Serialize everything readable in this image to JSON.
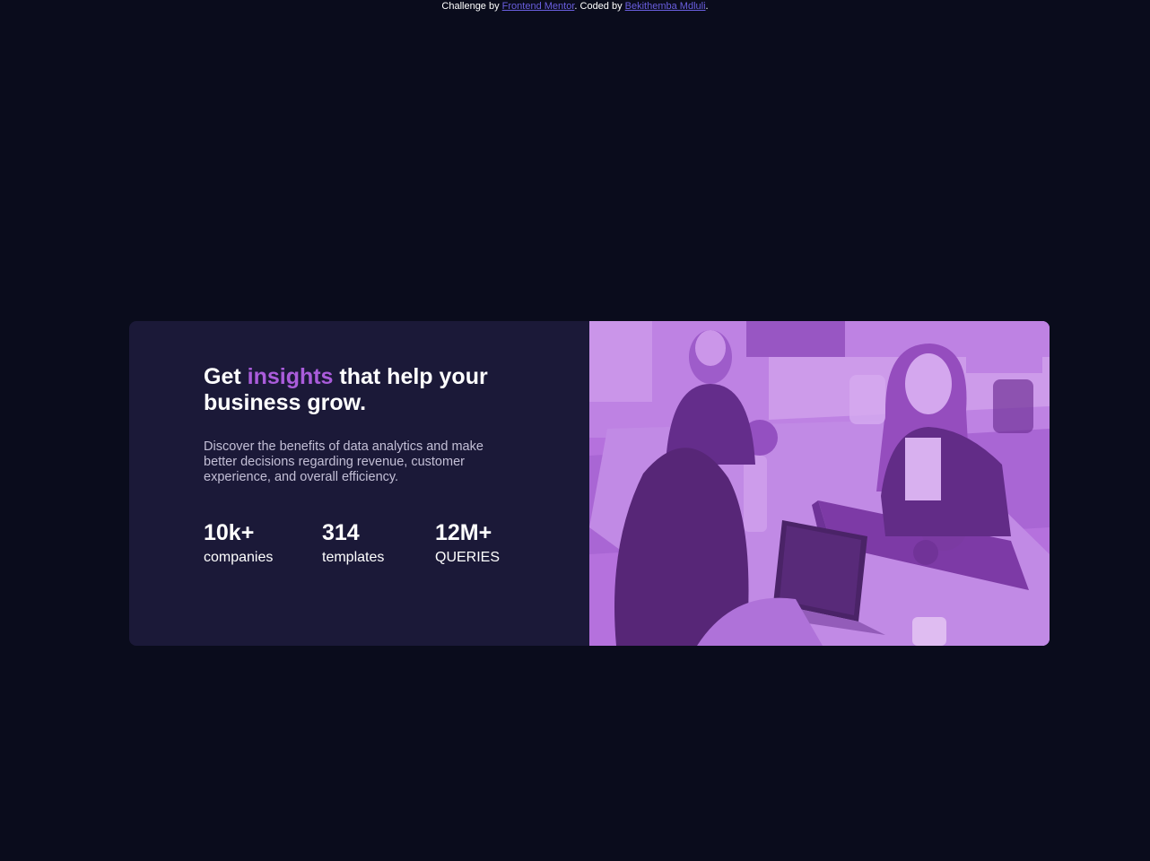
{
  "attribution": {
    "prefix": "Challenge by ",
    "link1": "Frontend Mentor",
    "middle": ". Coded by ",
    "link2": "Bekithemba Mdluli",
    "suffix": "."
  },
  "card": {
    "headline_start": "Get ",
    "headline_accent": "insights",
    "headline_end": " that help your business grow.",
    "description": "Discover the benefits of data analytics and make better decisions regarding revenue, customer experience, and overall efficiency.",
    "stats": [
      {
        "value": "10k+",
        "label": "companies"
      },
      {
        "value": "314",
        "label": "templates"
      },
      {
        "value": "12M+",
        "label": "QUERIES"
      }
    ],
    "image_icon": "office-photo"
  },
  "colors": {
    "page_bg": "#0a0c1c",
    "card_bg": "#1b1938",
    "accent": "#aa5cdb",
    "link": "#6a5fe0",
    "image_tint": "#aa5cdb"
  }
}
